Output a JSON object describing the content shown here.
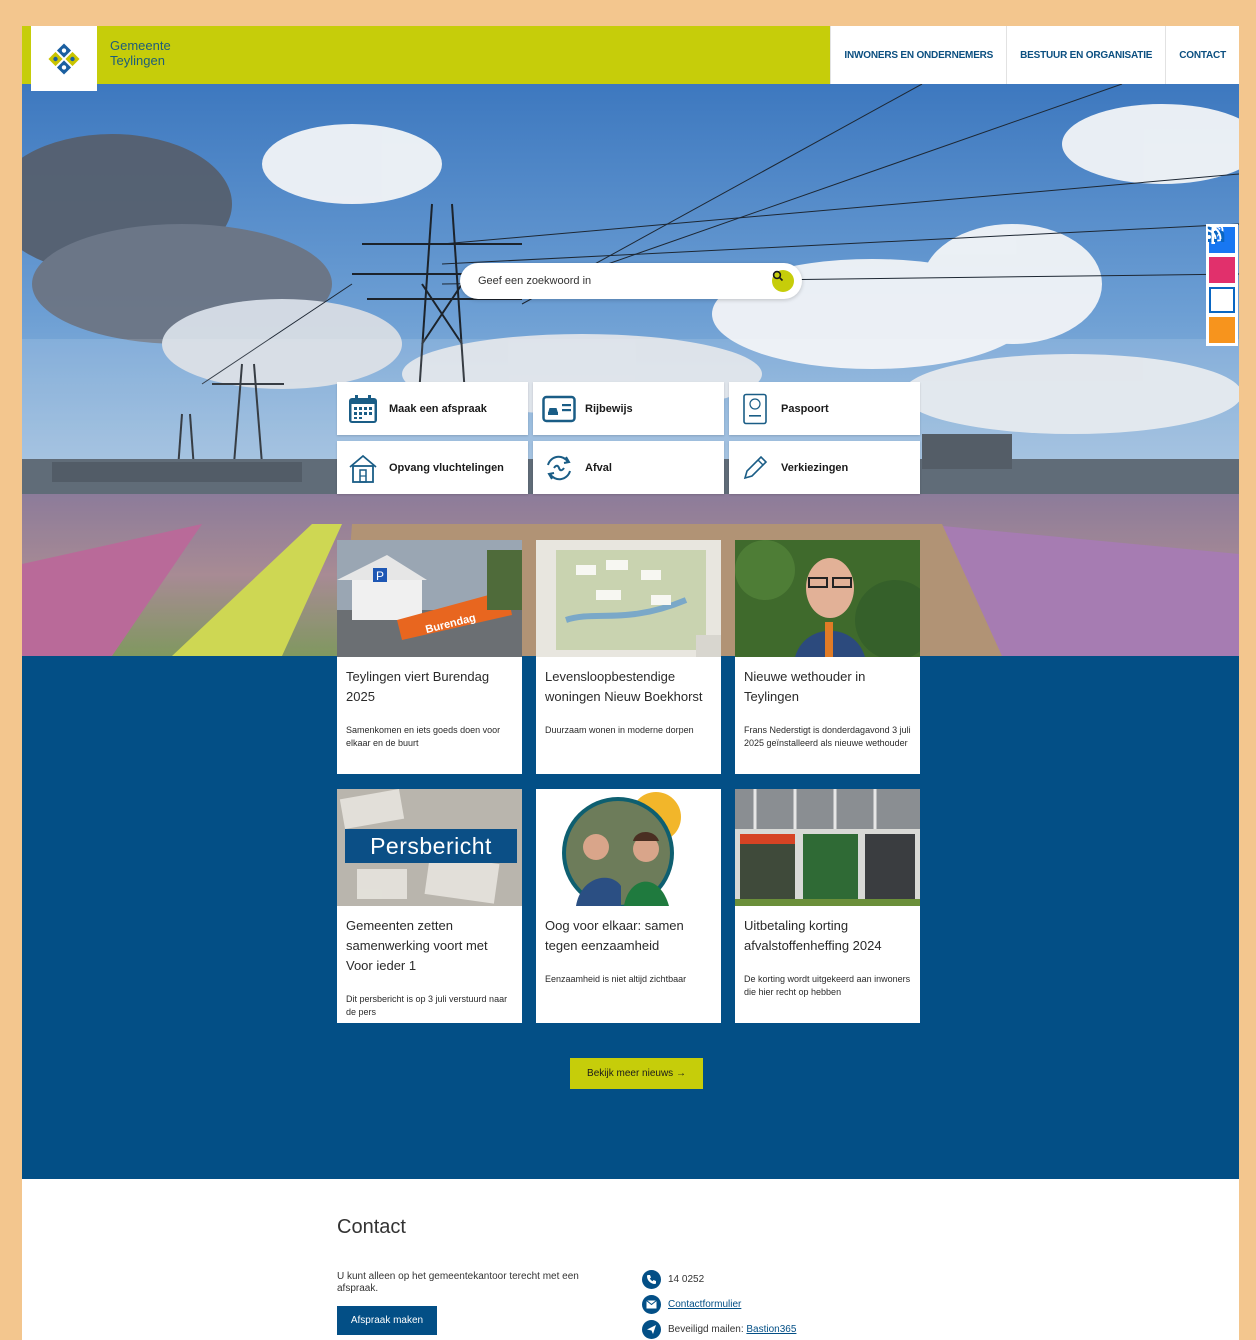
{
  "header": {
    "site_name_line1": "Gemeente",
    "site_name_line2": "Teylingen",
    "nav": [
      "INWONERS EN ONDERNEMERS",
      "BESTUUR EN ORGANISATIE",
      "CONTACT"
    ]
  },
  "search": {
    "placeholder": "Geef een zoekwoord in"
  },
  "social": [
    "facebook-icon",
    "instagram-icon",
    "linkedin-icon",
    "rss-icon"
  ],
  "quick_links": [
    {
      "label": "Maak een afspraak",
      "icon": "calendar-icon"
    },
    {
      "label": "Rijbewijs",
      "icon": "driving-license-icon"
    },
    {
      "label": "Paspoort",
      "icon": "passport-icon"
    },
    {
      "label": "Opvang vluchtelingen",
      "icon": "house-icon"
    },
    {
      "label": "Afval",
      "icon": "recycle-icon"
    },
    {
      "label": "Verkiezingen",
      "icon": "pencil-icon"
    }
  ],
  "news": [
    {
      "title": "Teylingen viert Burendag 2025",
      "summary": "Samenkomen en iets goeds doen voor elkaar en de buurt",
      "image_text": "Burendag"
    },
    {
      "title": "Levensloopbestendige woningen Nieuw Boekhorst",
      "summary": "Duurzaam wonen in moderne dorpen"
    },
    {
      "title": "Nieuwe wethouder in Teylingen",
      "summary": "Frans Nederstigt is donderdagavond 3 juli 2025 geïnstalleerd als nieuwe wethouder"
    },
    {
      "title": "Gemeenten zetten samenwerking voort met Voor ieder 1",
      "summary": "Dit persbericht is op 3 juli verstuurd naar de pers",
      "image_text": "Persbericht"
    },
    {
      "title": "Oog voor elkaar: samen tegen eenzaamheid",
      "summary": "Eenzaamheid is niet altijd zichtbaar"
    },
    {
      "title": "Uitbetaling korting afvalstoffenheffing 2024",
      "summary": "De korting wordt uitgekeerd aan inwoners die hier recht op hebben"
    }
  ],
  "more_news_label": "Bekijk meer nieuws →",
  "contact": {
    "title": "Contact",
    "text": "U kunt alleen op het gemeentekantoor terecht met een afspraak.",
    "button": "Afspraak maken",
    "phone": "14 0252",
    "form_link": "Contactformulier",
    "secure_mail_label": "Beveiligd mailen:",
    "secure_mail_link": "Bastion365"
  },
  "colors": {
    "accent": "#c6cd0a",
    "primary_blue": "#034f86",
    "frame": "#f3c68e"
  }
}
